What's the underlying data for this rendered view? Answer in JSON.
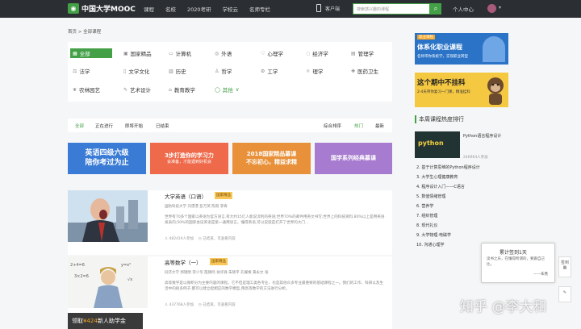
{
  "header": {
    "logo": "中国大学MOOC",
    "nav": [
      "课程",
      "名校",
      "2020考研",
      "学校云",
      "名师专栏"
    ],
    "app_label": "客户端",
    "search_placeholder": "搜索感兴趣的课程",
    "user_center": "个人中心"
  },
  "breadcrumb": "首页 > 全部课程",
  "categories": [
    {
      "label": "全部",
      "icon": "grid-icon"
    },
    {
      "label": "国家精品",
      "icon": "badge-icon"
    },
    {
      "label": "计算机",
      "icon": "monitor-icon"
    },
    {
      "label": "外语",
      "icon": "globe-icon"
    },
    {
      "label": "心理学",
      "icon": "heart-icon"
    },
    {
      "label": "经济学",
      "icon": "coin-icon"
    },
    {
      "label": "管理学",
      "icon": "chart-icon"
    },
    {
      "label": "法学",
      "icon": "scale-icon"
    },
    {
      "label": "文学文化",
      "icon": "book-icon"
    },
    {
      "label": "历史",
      "icon": "scroll-icon"
    },
    {
      "label": "哲学",
      "icon": "lamp-icon"
    },
    {
      "label": "工学",
      "icon": "gear-icon"
    },
    {
      "label": "理学",
      "icon": "atom-icon"
    },
    {
      "label": "医药卫生",
      "icon": "cross-icon"
    },
    {
      "label": "农林园艺",
      "icon": "leaf-icon"
    },
    {
      "label": "艺术设计",
      "icon": "palette-icon"
    },
    {
      "label": "教育教学",
      "icon": "edu-icon"
    },
    {
      "label": "其他",
      "icon": "more-icon"
    }
  ],
  "filters": {
    "status": [
      "全部",
      "正在进行",
      "即将开始",
      "已结束"
    ],
    "sort": [
      "综合排序",
      "热门",
      "最新"
    ]
  },
  "banners": [
    {
      "text1": "英语四级六级",
      "text2": "陪你考过为止",
      "color": "#3a7bd5"
    },
    {
      "text1": "3步打造你的学习力",
      "text2": "会准备，才能遇到好机会",
      "color": "#ee6a4a"
    },
    {
      "text1": "2018国家精品慕课",
      "text2": "不忘初心，精益求精",
      "color": "#e8913a"
    },
    {
      "text1": "国学系列经典慕课",
      "text2": "",
      "color": "#a77bcf"
    }
  ],
  "courses": [
    {
      "title": "大学英语（口语）",
      "badge": "国家精品",
      "meta": "国防科技大学    刘漂漂  彭万英  陈雨  李奇",
      "desc": "世界有70多个国家以英语为官方语言,有大约15亿人能说流利的英语;世界70%的邮件用英文书写;世界上的科技资料,80%以上是用英语发表的;50%的国际会议英语是第一通用语言。懂得英语,可以说就是打开了世界的大门...",
      "learners": "482419人参加",
      "status": "已结束，可查看内容"
    },
    {
      "title": "高等数学（一）",
      "badge": "国家精品",
      "meta": "同济大学    郭镜明  李少华  殷锡鸣  徐华锋  朱晓平  孔耀根  黄永文  张",
      "desc": "高等数学是以微积分为主要内容的课程。它不但是理工类各专业、也是其他众多专业最重要的基础课程之一。我们的工作、科研以及生活中的很多例子,都可以建立起相应的数学模型,用高等数学的方法进行分析。",
      "learners": "437768人参加",
      "status": "已结束，可查看内容"
    }
  ],
  "ads": {
    "ad1_tag": "就业课程",
    "ad1_title": "体系化职业课程",
    "ad1_sub": "名师带你系统学，实现职业转型",
    "ad2_title": "这个期中不挂科",
    "ad2_sub": "2-4天带你复习一门课，精准挂科"
  },
  "ranking": {
    "title": "本周课程热度排行",
    "top": {
      "title": "Python语言程序设计",
      "learners": "246964人参加",
      "img_text": "python"
    },
    "items": [
      "2. 基于计算思维的Python程序设计",
      "3. 大学生心理健康教育",
      "4. 程序设计入门——C语言",
      "5. 数值情绪管理",
      "6. 营养学",
      "7. 组织管理",
      "8. 现代礼仪",
      "9. 大学物理·电磁学",
      "10. 沟通心理学"
    ]
  },
  "sign": {
    "title": "累计签到1天",
    "quote": "读书之乐，在懂得所谓的，要跟自己比。",
    "author": "——朱熹"
  },
  "side": {
    "sign": "签到",
    "feedback": "反馈"
  },
  "watermark": "知乎 @李大和",
  "cta": {
    "pre": "领取",
    "amount": "¥424",
    "post": "新人助学金"
  }
}
